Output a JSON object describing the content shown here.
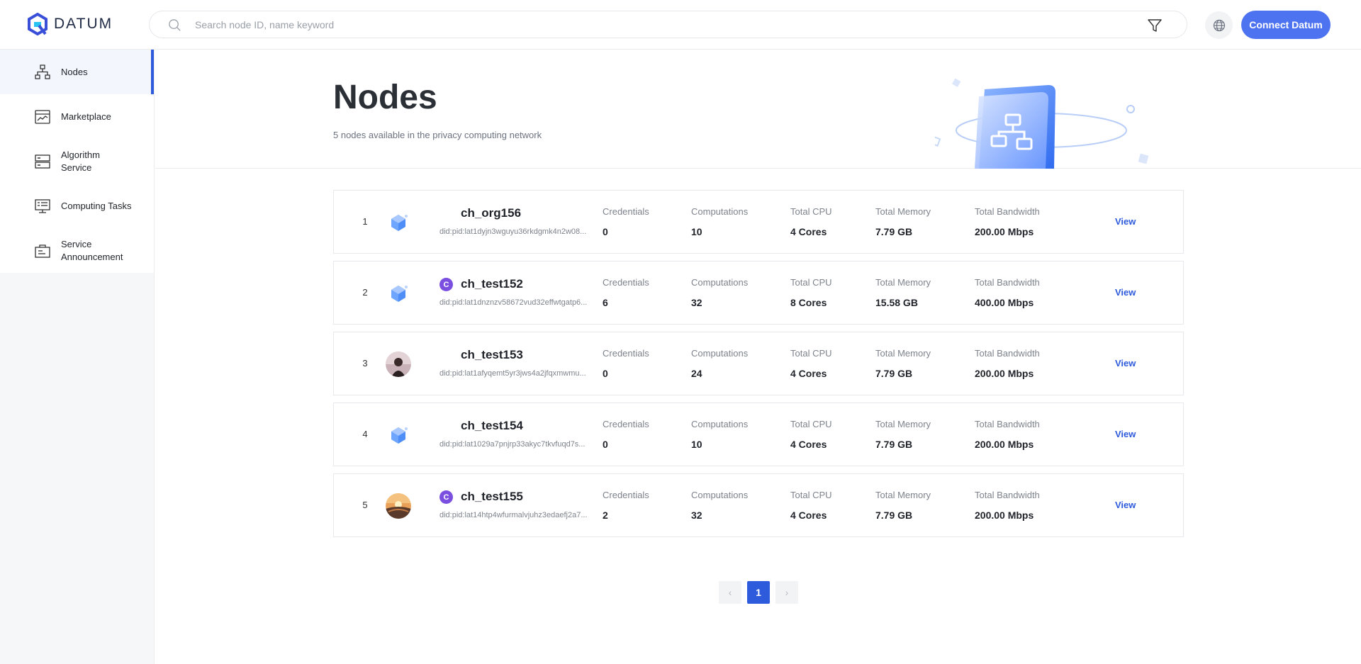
{
  "brand": {
    "name": "DATUM"
  },
  "search": {
    "placeholder": "Search node ID, name keyword"
  },
  "header": {
    "connect_label": "Connect Datum"
  },
  "sidebar": {
    "items": [
      {
        "label": "Nodes",
        "icon": "nodes-icon",
        "active": true
      },
      {
        "label": "Marketplace",
        "icon": "marketplace-icon",
        "active": false
      },
      {
        "label": "Algorithm Service",
        "icon": "algorithm-service-icon",
        "active": false
      },
      {
        "label": "Computing Tasks",
        "icon": "computing-tasks-icon",
        "active": false
      },
      {
        "label": "Service Announcement",
        "icon": "announcement-icon",
        "active": false
      }
    ]
  },
  "hero": {
    "title": "Nodes",
    "subtitle": "5 nodes available in the privacy computing network"
  },
  "columns": {
    "credentials": "Credentials",
    "computations": "Computations",
    "cpu": "Total CPU",
    "memory": "Total Memory",
    "bandwidth": "Total Bandwidth",
    "view": "View"
  },
  "nodes": [
    {
      "index": "1",
      "name": "ch_org156",
      "did": "did:pid:lat1dyjn3wguyu36rkdgmk4n2w08...",
      "credentials": "0",
      "computations": "10",
      "cpu": "4 Cores",
      "memory": "7.79 GB",
      "bandwidth": "200.00 Mbps",
      "badge": "",
      "avatar": "cube"
    },
    {
      "index": "2",
      "name": "ch_test152",
      "did": "did:pid:lat1dnznzv58672vud32effwtgatp6...",
      "credentials": "6",
      "computations": "32",
      "cpu": "8 Cores",
      "memory": "15.58 GB",
      "bandwidth": "400.00 Mbps",
      "badge": "C",
      "avatar": "cube"
    },
    {
      "index": "3",
      "name": "ch_test153",
      "did": "did:pid:lat1afyqemt5yr3jws4a2jfqxmwmu...",
      "credentials": "0",
      "computations": "24",
      "cpu": "4 Cores",
      "memory": "7.79 GB",
      "bandwidth": "200.00 Mbps",
      "badge": "",
      "avatar": "photo-person"
    },
    {
      "index": "4",
      "name": "ch_test154",
      "did": "did:pid:lat1029a7pnjrp33akyc7tkvfuqd7s...",
      "credentials": "0",
      "computations": "10",
      "cpu": "4 Cores",
      "memory": "7.79 GB",
      "bandwidth": "200.00 Mbps",
      "badge": "",
      "avatar": "cube"
    },
    {
      "index": "5",
      "name": "ch_test155",
      "did": "did:pid:lat14htp4wfurmalvjuhz3edaefj2a7...",
      "credentials": "2",
      "computations": "32",
      "cpu": "4 Cores",
      "memory": "7.79 GB",
      "bandwidth": "200.00 Mbps",
      "badge": "C",
      "avatar": "photo-sunset"
    }
  ],
  "pagination": {
    "prev": "‹",
    "current": "1",
    "next": "›"
  },
  "colors": {
    "accent": "#2d5bdb",
    "button": "#4e73f0",
    "badge": "#7b4fe0"
  }
}
